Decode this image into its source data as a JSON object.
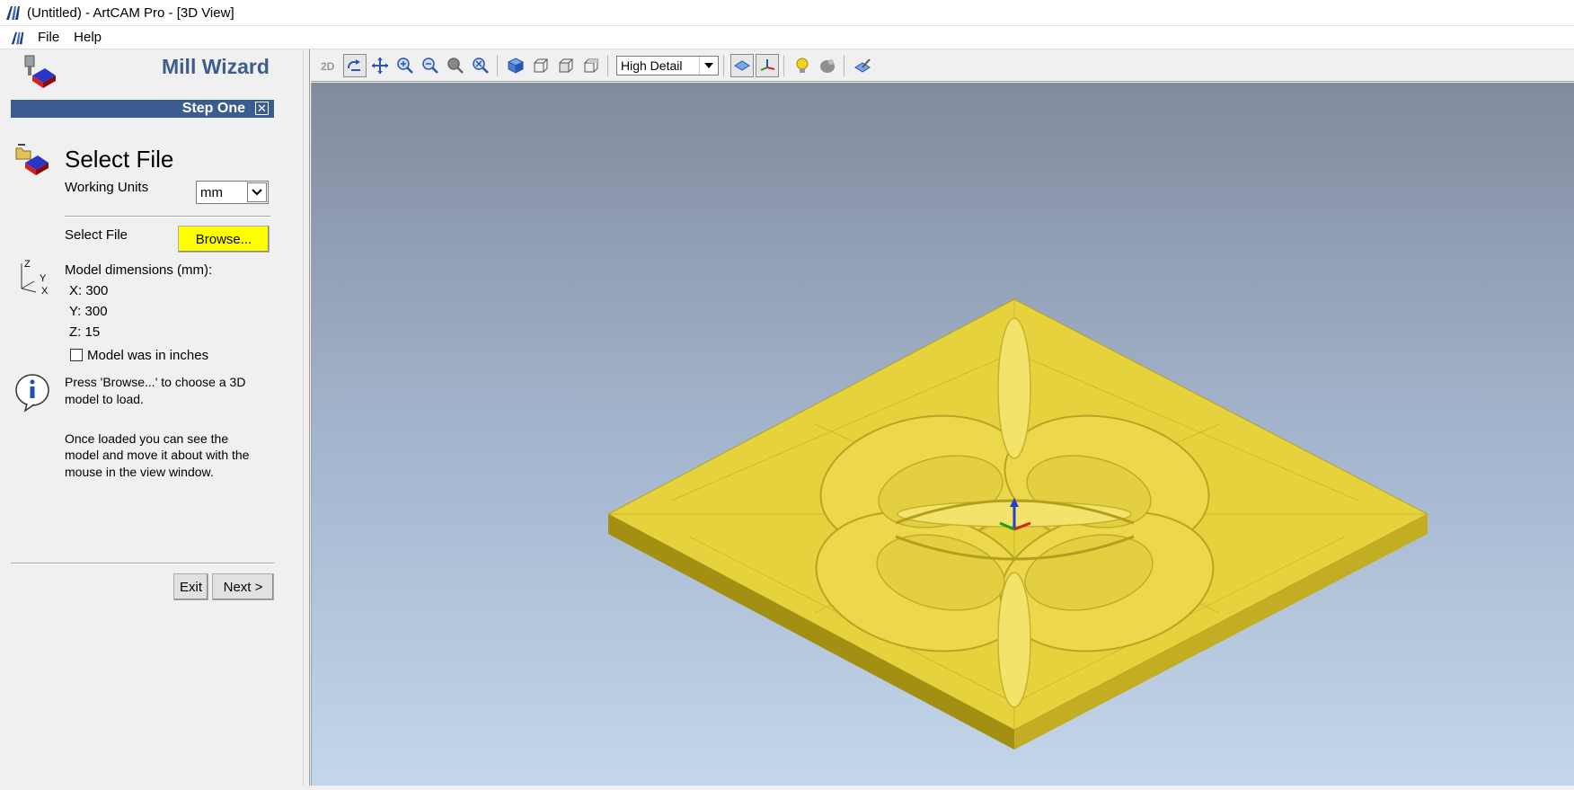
{
  "window": {
    "title": "(Untitled) - ArtCAM Pro - [3D View]"
  },
  "menu": {
    "items": [
      "File",
      "Help"
    ]
  },
  "wizard": {
    "title": "Mill Wizard",
    "step_label": "Step One",
    "heading": "Select File",
    "working_units_label": "Working Units",
    "working_units_value": "mm",
    "select_file_label": "Select File",
    "browse_label": "Browse...",
    "model_dimensions_label": "Model dimensions (mm):",
    "dim_x": "X: 300",
    "dim_y": "Y: 300",
    "dim_z": "Z: 15",
    "inches_checkbox_label": "Model was in inches",
    "inches_checked": false,
    "info_line1": "Press 'Browse...' to choose a 3D",
    "info_line2": "model to load.",
    "info_para2_line1": "Once loaded you can see the",
    "info_para2_line2": "model and move it about with the",
    "info_para2_line3": "mouse in the view window.",
    "exit_label": "Exit",
    "next_label": "Next >",
    "axis_labels": {
      "z": "Z",
      "y": "Y",
      "x": "X"
    }
  },
  "toolbar": {
    "view_2d_label": "2D",
    "detail_value": "High Detail",
    "icons": [
      "2d-view-icon",
      "rotate-icon",
      "pan-icon",
      "zoom-in-icon",
      "zoom-out-icon",
      "zoom-box-icon",
      "zoom-fit-icon",
      "iso-view-icon",
      "front-view-icon",
      "side-view-icon",
      "top-view-icon",
      "light-toggle-icon",
      "axes-toggle-icon",
      "lightbulb-icon",
      "material-icon",
      "render-icon"
    ]
  },
  "colors": {
    "accent": "#3a5c8e",
    "wizard_title": "#3e5d8a",
    "browse_highlight": "#ffff00",
    "model_gold": "#d8c530"
  }
}
